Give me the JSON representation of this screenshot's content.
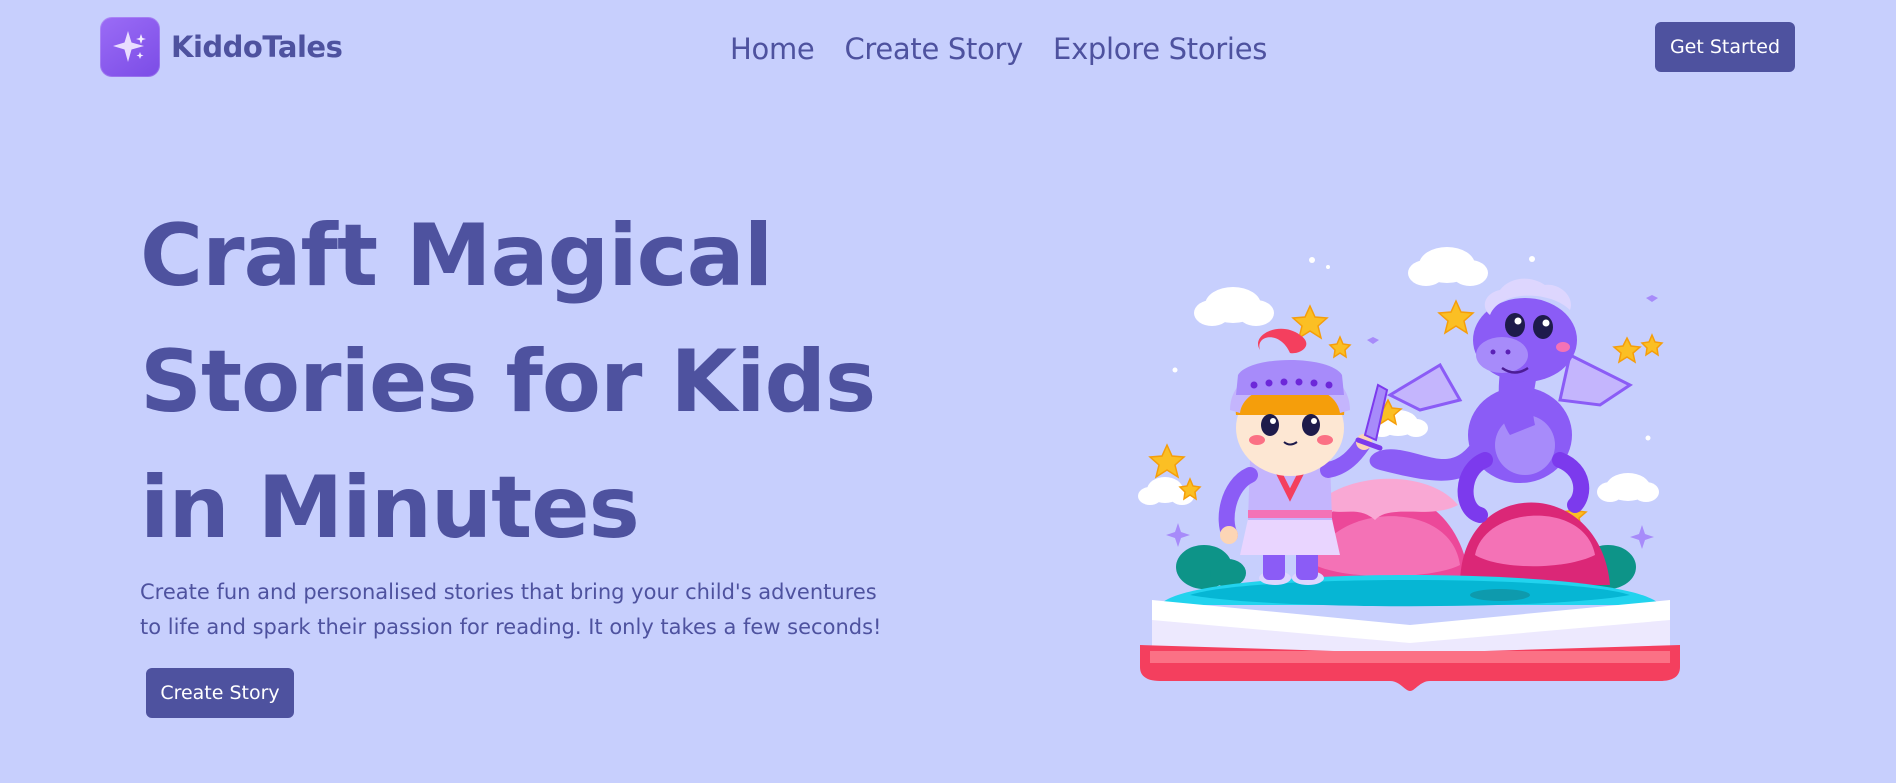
{
  "brand": {
    "name": "KiddoTales",
    "logo_icon": "sparkle-icon",
    "accent": "#4e529f",
    "logo_color": "#8b5cf6",
    "background": "#c7cffd"
  },
  "nav": {
    "links": [
      "Home",
      "Create Story",
      "Explore Stories"
    ],
    "cta_label": "Get Started"
  },
  "hero": {
    "title_lines": [
      "Craft Magical",
      "Stories for Kids",
      "in Minutes"
    ],
    "subtitle_lines": [
      "Create fun and personalised stories that bring your child's adventures",
      "to life and spark their passion for reading. It only takes a few seconds!"
    ],
    "cta_label": "Create Story",
    "illustration": "knight-and-dragon-storybook-illustration"
  }
}
